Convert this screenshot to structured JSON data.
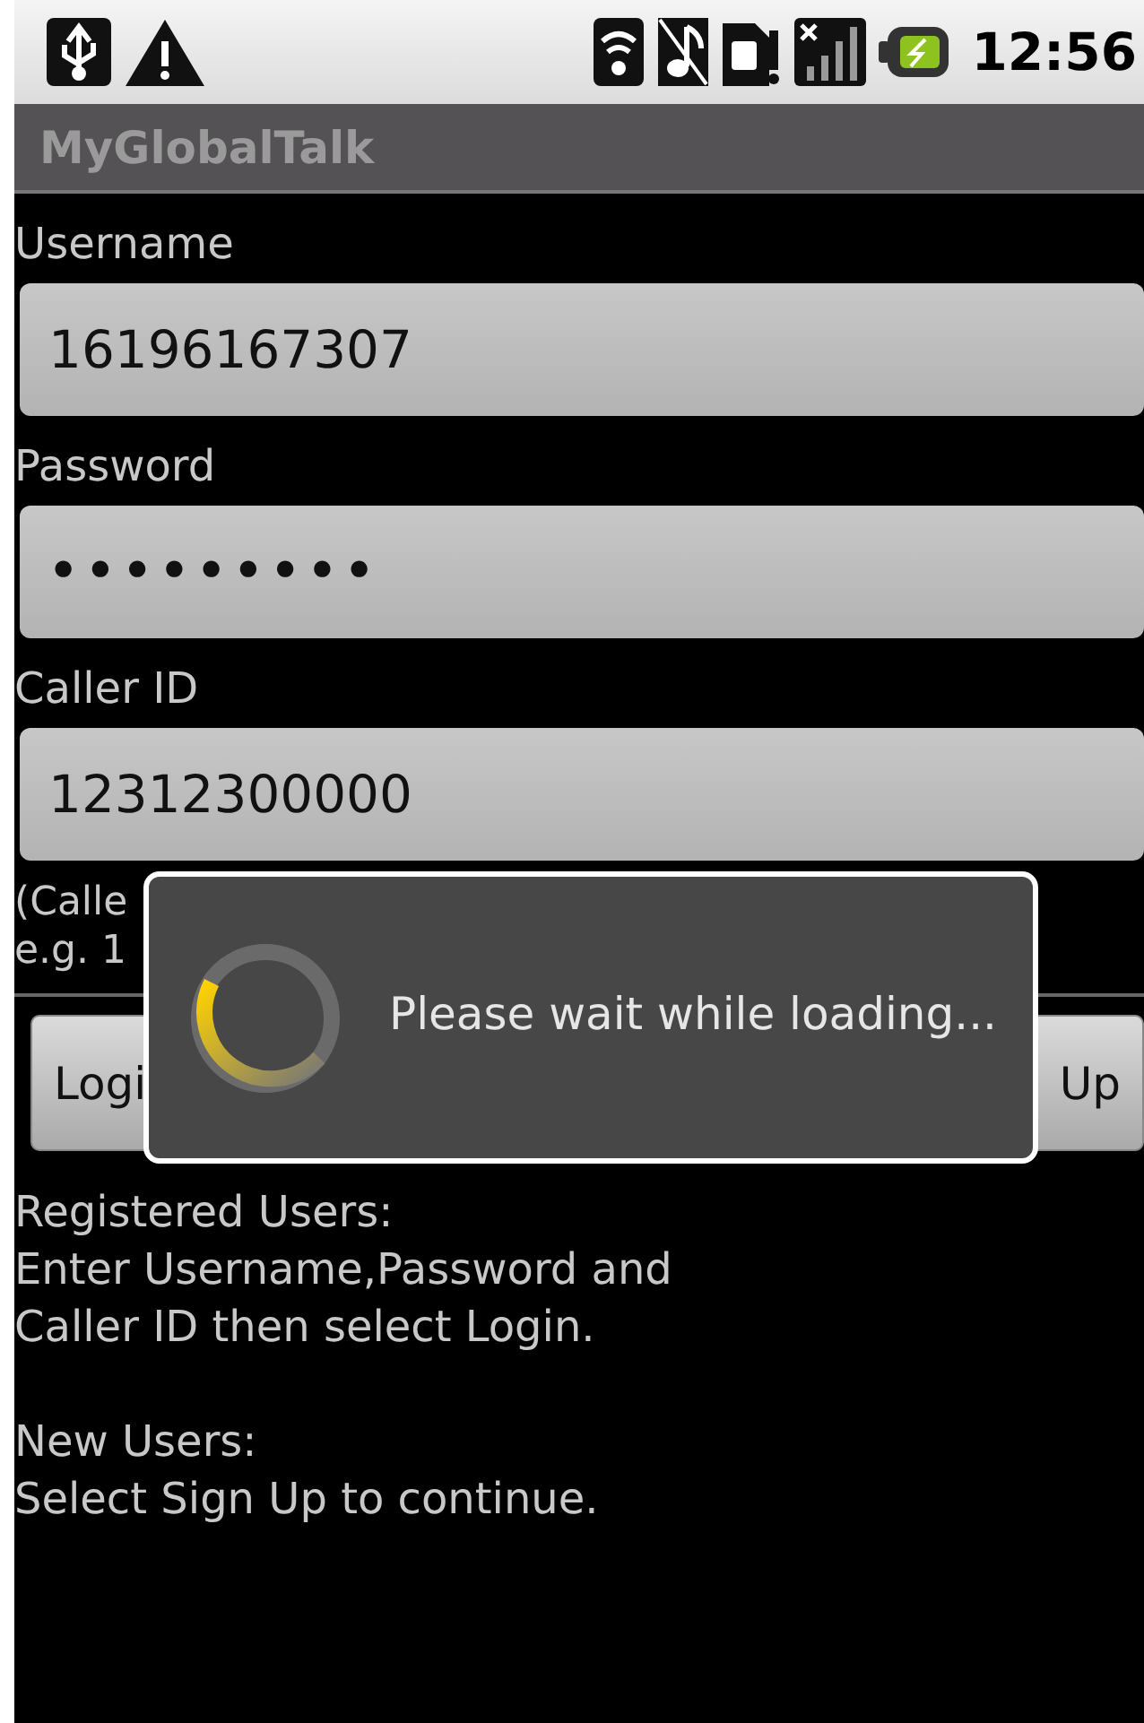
{
  "status_bar": {
    "time": "12:56"
  },
  "title_bar": {
    "title": "MyGlobalTalk"
  },
  "form": {
    "fields": [
      {
        "label": "Username",
        "value": "16196167307",
        "kind": "text"
      },
      {
        "label": "Password",
        "value": "•••••••••",
        "kind": "password"
      },
      {
        "label": "Caller ID",
        "value": "12312300000",
        "kind": "text"
      }
    ],
    "note": [
      "(Calle",
      "e.g. 1"
    ],
    "buttons": [
      {
        "label": "Logi"
      },
      {
        "label": "Up"
      }
    ],
    "instructions": [
      [
        "Registered Users:",
        "Enter Username,Password and",
        "Caller ID then select Login."
      ],
      [
        "New Users:",
        "Select Sign Up to continue."
      ]
    ]
  },
  "dialog": {
    "message": "Please wait while loading..."
  }
}
